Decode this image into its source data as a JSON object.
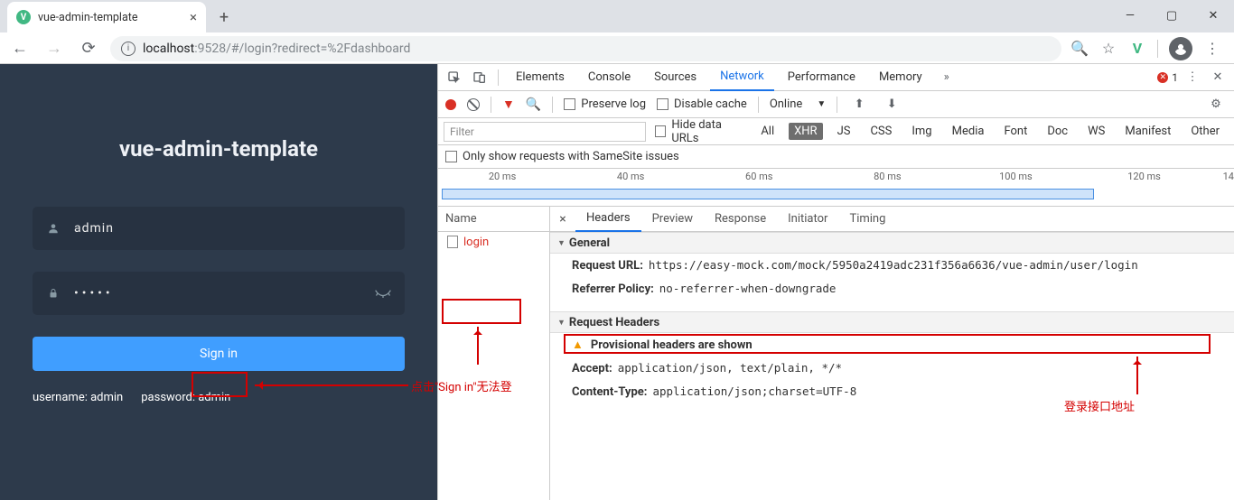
{
  "browser": {
    "tab_title": "vue-admin-template",
    "url_host": "localhost",
    "url_port_path": ":9528/#/login?redirect=%2Fdashboard"
  },
  "login": {
    "title": "vue-admin-template",
    "username": "admin",
    "password": "•••••",
    "signin": "Sign in",
    "hint_user": "username: admin",
    "hint_pass": "password: admin"
  },
  "devtools": {
    "tabs": [
      "Elements",
      "Console",
      "Sources",
      "Network",
      "Performance",
      "Memory"
    ],
    "active_tab": "Network",
    "error_count": "1",
    "toolbar": {
      "preserve_log": "Preserve log",
      "disable_cache": "Disable cache",
      "throttle": "Online"
    },
    "filter": {
      "placeholder": "Filter",
      "hide_data_urls": "Hide data URLs",
      "types": [
        "All",
        "XHR",
        "JS",
        "CSS",
        "Img",
        "Media",
        "Font",
        "Doc",
        "WS",
        "Manifest",
        "Other"
      ],
      "selected": "XHR"
    },
    "samesite": "Only show requests with SameSite issues",
    "timeline_ticks": [
      "20 ms",
      "40 ms",
      "60 ms",
      "80 ms",
      "100 ms",
      "120 ms",
      "14"
    ],
    "name_header": "Name",
    "requests": [
      "login"
    ],
    "detail_tabs": [
      "Headers",
      "Preview",
      "Response",
      "Initiator",
      "Timing"
    ],
    "detail_active": "Headers",
    "sections": {
      "general": "General",
      "request_headers": "Request Headers"
    },
    "general": {
      "request_url_label": "Request URL:",
      "request_url": "https://easy-mock.com/mock/5950a2419adc231f356a6636/vue-admin/user/login",
      "referrer_policy_label": "Referrer Policy:",
      "referrer_policy": "no-referrer-when-downgrade"
    },
    "provisional": "Provisional headers are shown",
    "req_headers": {
      "accept_label": "Accept:",
      "accept": "application/json, text/plain, */*",
      "content_type_label": "Content-Type:",
      "content_type": "application/json;charset=UTF-8"
    }
  },
  "annotations": {
    "signin_note": "点击\"Sign in\"无法登",
    "url_note": "登录接口地址"
  }
}
